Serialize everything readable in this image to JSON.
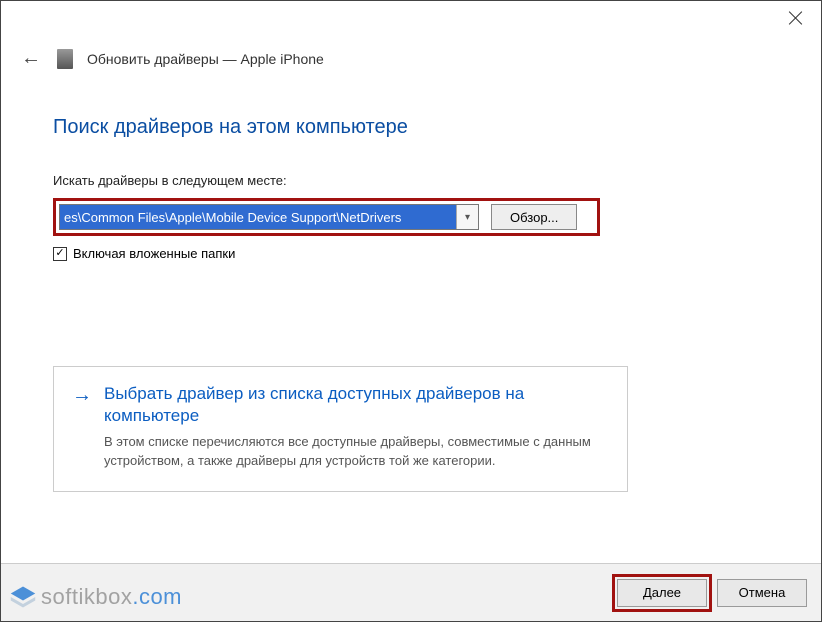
{
  "window": {
    "title": "Обновить драйверы — Apple iPhone"
  },
  "heading": "Поиск драйверов на этом компьютере",
  "path_label": "Искать драйверы в следующем месте:",
  "path_value": "es\\Common Files\\Apple\\Mobile Device Support\\NetDrivers",
  "browse_button": "Обзор...",
  "include_subfolders_label": "Включая вложенные папки",
  "include_subfolders_checked": true,
  "option": {
    "title": "Выбрать драйвер из списка доступных драйверов на компьютере",
    "description": "В этом списке перечисляются все доступные драйверы, совместимые с данным устройством, а также драйверы для устройств той же категории."
  },
  "footer": {
    "next": "Далее",
    "cancel": "Отмена"
  },
  "watermark": {
    "brand": "softikbox",
    "tld": ".com"
  }
}
